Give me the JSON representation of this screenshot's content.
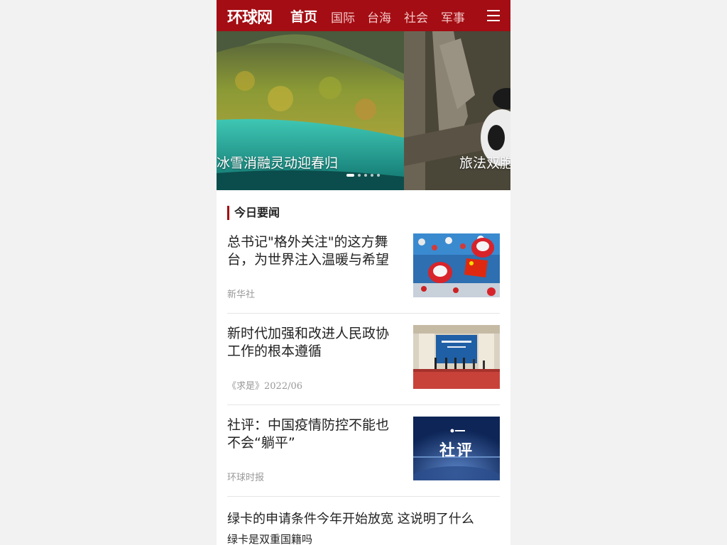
{
  "header": {
    "logo": "环球网",
    "tabs": [
      {
        "label": "首页",
        "active": true
      },
      {
        "label": "国际",
        "active": false
      },
      {
        "label": "台海",
        "active": false
      },
      {
        "label": "社会",
        "active": false
      },
      {
        "label": "军事",
        "active": false
      }
    ],
    "menu_icon": "hamburger-menu-icon",
    "color": "#a30d13"
  },
  "carousel": {
    "slides": [
      {
        "caption": "冰雪消融灵动迎春归"
      },
      {
        "caption": "旅法双胞"
      }
    ],
    "dot_count": 5,
    "active_dot": 0
  },
  "section": {
    "title": "今日要闻"
  },
  "news": [
    {
      "title": "总书记\"格外关注\"的这方舞台，为世界注入温暖与希望",
      "source": "新华社"
    },
    {
      "title": "新时代加强和改进人民政协工作的根本遵循",
      "source": "《求是》2022/06"
    },
    {
      "title": "社评：中国疫情防控不能也不会“躺平”",
      "source": "环球时报",
      "thumb_text": "社评"
    }
  ],
  "plain_news": {
    "title": "绿卡的申请条件今年开始放宽 这说明了什么",
    "subtitle": "绿卡是双重国籍吗"
  }
}
